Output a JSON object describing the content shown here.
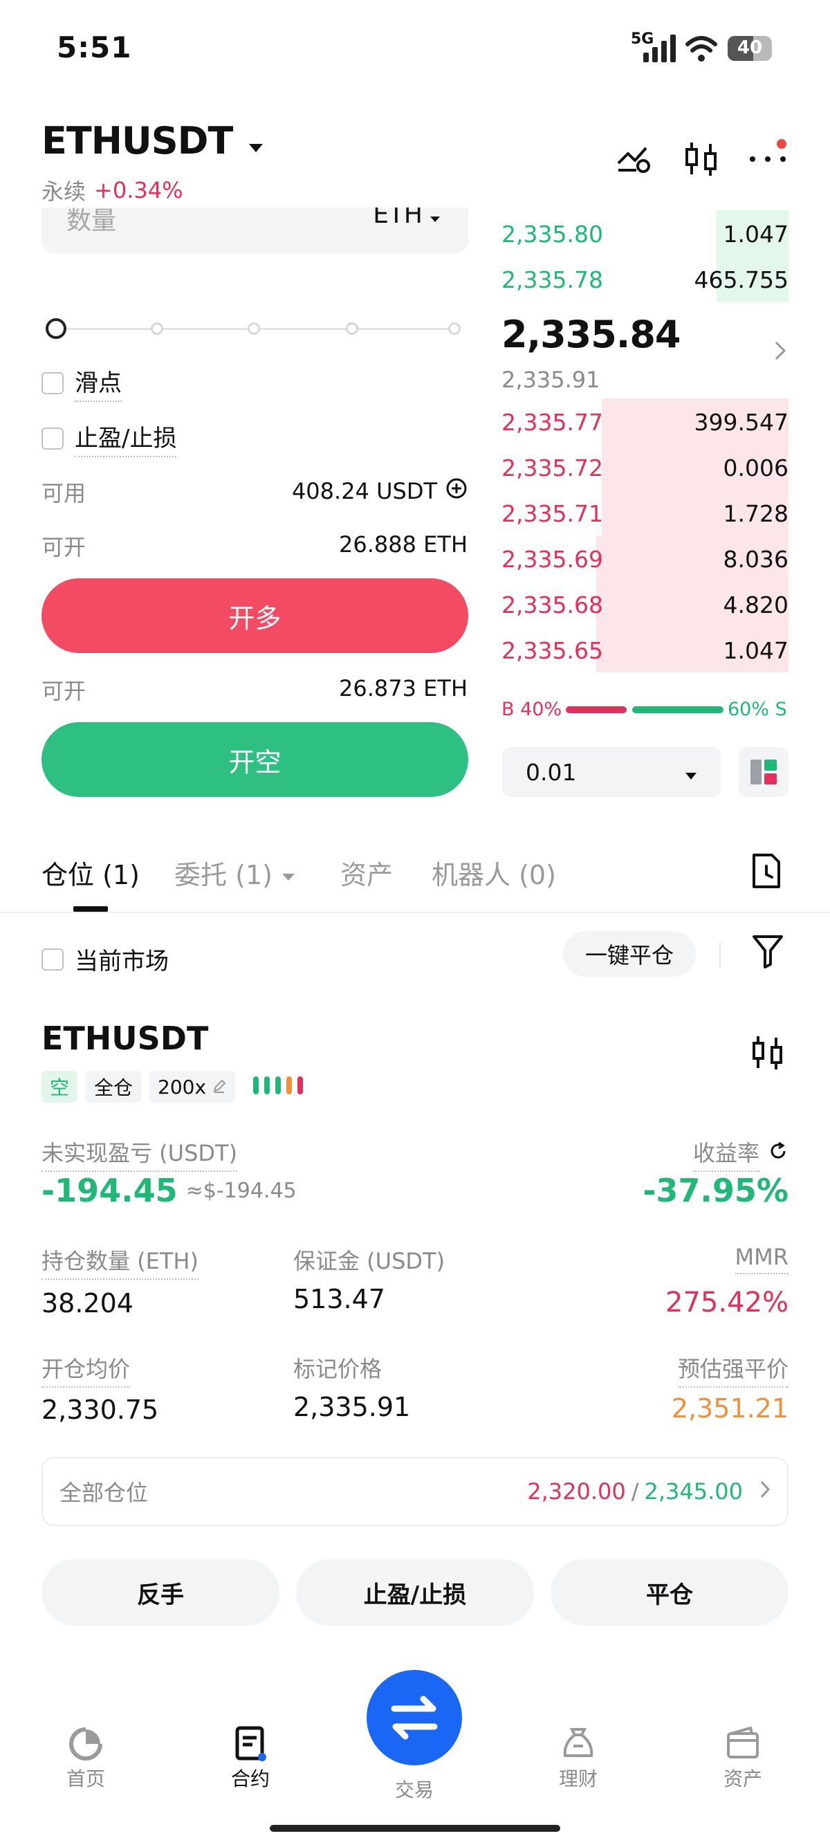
{
  "status": {
    "time": "5:51",
    "network": "5G",
    "battery": "40"
  },
  "header": {
    "symbol": "ETHUSDT",
    "contract_type": "永续",
    "change": "+0.34%"
  },
  "form": {
    "qty_placeholder": "数量",
    "qty_unit": "ETH",
    "slippage_label": "滑点",
    "tpsl_label": "止盈/止损",
    "available_label": "可用",
    "available_value": "408.24 USDT",
    "open_long_label": "可开",
    "open_long_value": "26.888 ETH",
    "long_button": "开多",
    "open_short_label": "可开",
    "open_short_value": "26.873 ETH",
    "short_button": "开空"
  },
  "orderbook": {
    "asks": [
      {
        "price": "2,335.80",
        "qty": "1.047",
        "depth": 0.25
      },
      {
        "price": "2,335.78",
        "qty": "465.755",
        "depth": 0.25
      }
    ],
    "last_price": "2,335.84",
    "mark_price": "2,335.91",
    "bids": [
      {
        "price": "2,335.77",
        "qty": "399.547",
        "depth": 0.65
      },
      {
        "price": "2,335.72",
        "qty": "0.006",
        "depth": 0.65
      },
      {
        "price": "2,335.71",
        "qty": "1.728",
        "depth": 0.65
      },
      {
        "price": "2,335.69",
        "qty": "8.036",
        "depth": 0.67
      },
      {
        "price": "2,335.68",
        "qty": "4.820",
        "depth": 0.67
      },
      {
        "price": "2,335.65",
        "qty": "1.047",
        "depth": 0.67
      }
    ],
    "buy_ratio_label": "B 40%",
    "sell_ratio_label": "60% S",
    "buy_ratio": 0.4,
    "precision": "0.01"
  },
  "tabs": {
    "positions": "仓位 (1)",
    "orders": "委托 (1)",
    "assets": "资产",
    "bots": "机器人 (0)"
  },
  "filters": {
    "current_market": "当前市场",
    "close_all": "一键平仓"
  },
  "position": {
    "symbol": "ETHUSDT",
    "side": "空",
    "margin_mode": "全仓",
    "leverage": "200x",
    "upnl_label": "未实现盈亏 (USDT)",
    "upnl_value": "-194.45",
    "upnl_approx": "≈$-194.45",
    "roe_label": "收益率",
    "roe_value": "-37.95%",
    "size_label": "持仓数量 (ETH)",
    "size_value": "38.204",
    "margin_label": "保证金 (USDT)",
    "margin_value": "513.47",
    "mmr_label": "MMR",
    "mmr_value": "275.42%",
    "entry_label": "开仓均价",
    "entry_value": "2,330.75",
    "mark_label": "标记价格",
    "mark_value": "2,335.91",
    "liq_label": "预估强平价",
    "liq_value": "2,351.21",
    "all_positions_label": "全部仓位",
    "tp_value": "2,320.00",
    "sep": "/",
    "sl_value": "2,345.00"
  },
  "actions": {
    "reverse": "反手",
    "tpsl": "止盈/止损",
    "close": "平仓"
  },
  "nav": {
    "home": "首页",
    "futures": "合约",
    "trade": "交易",
    "earn": "理财",
    "assets": "资产"
  },
  "colors": {
    "green": "#1fb877",
    "red": "#e3305a",
    "long_button": "#f44b64",
    "short_button": "#2ebf82",
    "nav_trade": "#1a66f5"
  }
}
